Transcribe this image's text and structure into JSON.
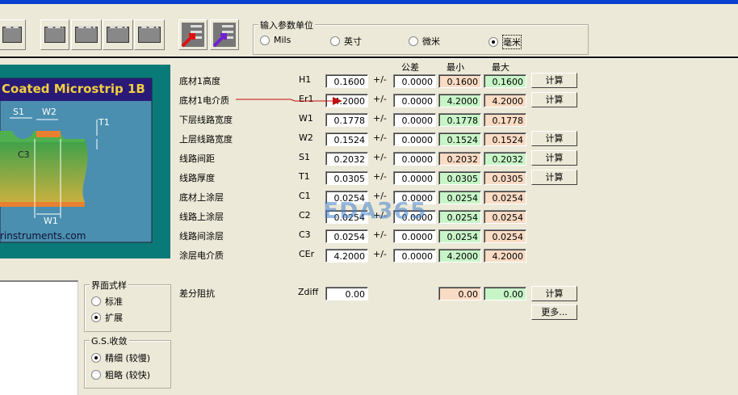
{
  "units": {
    "title": "输入参数单位",
    "options": [
      {
        "label": "Mils",
        "selected": false
      },
      {
        "label": "英寸",
        "selected": false
      },
      {
        "label": "微米",
        "selected": false
      },
      {
        "label": "毫米",
        "selected": true
      }
    ]
  },
  "diagram": {
    "title": "Coated Microstrip 1B",
    "labels": [
      "S1",
      "W2",
      "T1",
      "C3",
      "W1"
    ],
    "url": "rinstruments.com"
  },
  "headers": {
    "tolerance": "公差",
    "min": "最小",
    "max": "最大"
  },
  "plusminus": "+/-",
  "calc_label": "计算",
  "rows": [
    {
      "label": "底材1高度",
      "sym": "H1",
      "value": "0.1600",
      "tol": "0.0000",
      "min": "0.1600",
      "max": "0.1600",
      "min_color": "o",
      "max_color": "g",
      "calc": true
    },
    {
      "label": "底材1电介质",
      "sym": "Er1",
      "value": "4.2000",
      "tol": "0.0000",
      "min": "4.2000",
      "max": "4.2000",
      "min_color": "g",
      "max_color": "o",
      "calc": true
    },
    {
      "label": "下层线路宽度",
      "sym": "W1",
      "value": "0.1778",
      "tol": "0.0000",
      "min": "0.1778",
      "max": "0.1778",
      "min_color": "g",
      "max_color": "o",
      "calc": false
    },
    {
      "label": "上层线路宽度",
      "sym": "W2",
      "value": "0.1524",
      "tol": "0.0000",
      "min": "0.1524",
      "max": "0.1524",
      "min_color": "g",
      "max_color": "o",
      "calc": true
    },
    {
      "label": "线路间距",
      "sym": "S1",
      "value": "0.2032",
      "tol": "0.0000",
      "min": "0.2032",
      "max": "0.2032",
      "min_color": "o",
      "max_color": "g",
      "calc": true
    },
    {
      "label": "线路厚度",
      "sym": "T1",
      "value": "0.0305",
      "tol": "0.0000",
      "min": "0.0305",
      "max": "0.0305",
      "min_color": "g",
      "max_color": "o",
      "calc": true
    },
    {
      "label": "底材上涂层",
      "sym": "C1",
      "value": "0.0254",
      "tol": "0.0000",
      "min": "0.0254",
      "max": "0.0254",
      "min_color": "g",
      "max_color": "o",
      "calc": false
    },
    {
      "label": "线路上涂层",
      "sym": "C2",
      "value": "0.0254",
      "tol": "0.0000",
      "min": "0.0254",
      "max": "0.0254",
      "min_color": "g",
      "max_color": "o",
      "calc": false
    },
    {
      "label": "线路间涂层",
      "sym": "C3",
      "value": "0.0254",
      "tol": "0.0000",
      "min": "0.0254",
      "max": "0.0254",
      "min_color": "g",
      "max_color": "o",
      "calc": false
    },
    {
      "label": "涂层电介质",
      "sym": "CEr",
      "value": "4.2000",
      "tol": "0.0000",
      "min": "4.2000",
      "max": "4.2000",
      "min_color": "g",
      "max_color": "o",
      "calc": false
    }
  ],
  "zdiff": {
    "label": "差分阻抗",
    "sym": "Zdiff",
    "value": "0.00",
    "min": "0.00",
    "max": "0.00",
    "calc": "计算",
    "more": "更多..."
  },
  "style_group": {
    "title": "界面式样",
    "options": [
      {
        "label": "标准",
        "selected": false
      },
      {
        "label": "扩展",
        "selected": true
      }
    ]
  },
  "gs_group": {
    "title": "G.S.收敛",
    "options": [
      {
        "label": "精细 (较慢)",
        "selected": true
      },
      {
        "label": "粗略 (较快)",
        "selected": false
      }
    ]
  },
  "watermark": "EDA365",
  "colors": {
    "green": "#c8f5c8",
    "orange": "#fadbc4",
    "teal": "#0a7a78",
    "panel": "#4a8fb0",
    "title_bg": "#2a1a78",
    "title_fg": "#f0d040"
  }
}
